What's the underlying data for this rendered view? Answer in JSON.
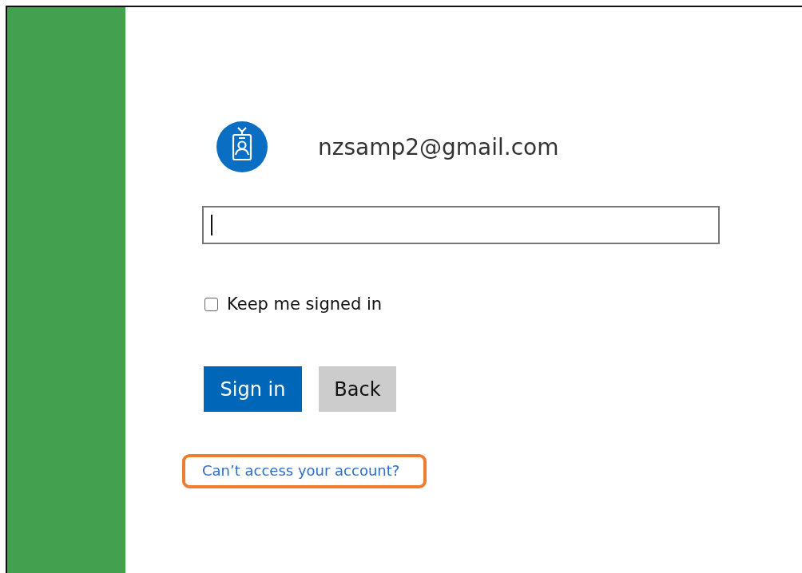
{
  "account": {
    "email": "nzsamp2@gmail.com"
  },
  "password_field": {
    "focused": true
  },
  "keep_signed_in": {
    "label": "Keep me signed in",
    "checked": false
  },
  "buttons": [
    {
      "label": "Sign in",
      "kind": "primary"
    },
    {
      "label": "Back",
      "kind": "secondary"
    }
  ],
  "help_link": {
    "text": "Can’t access your account?",
    "highlighted": true
  }
}
